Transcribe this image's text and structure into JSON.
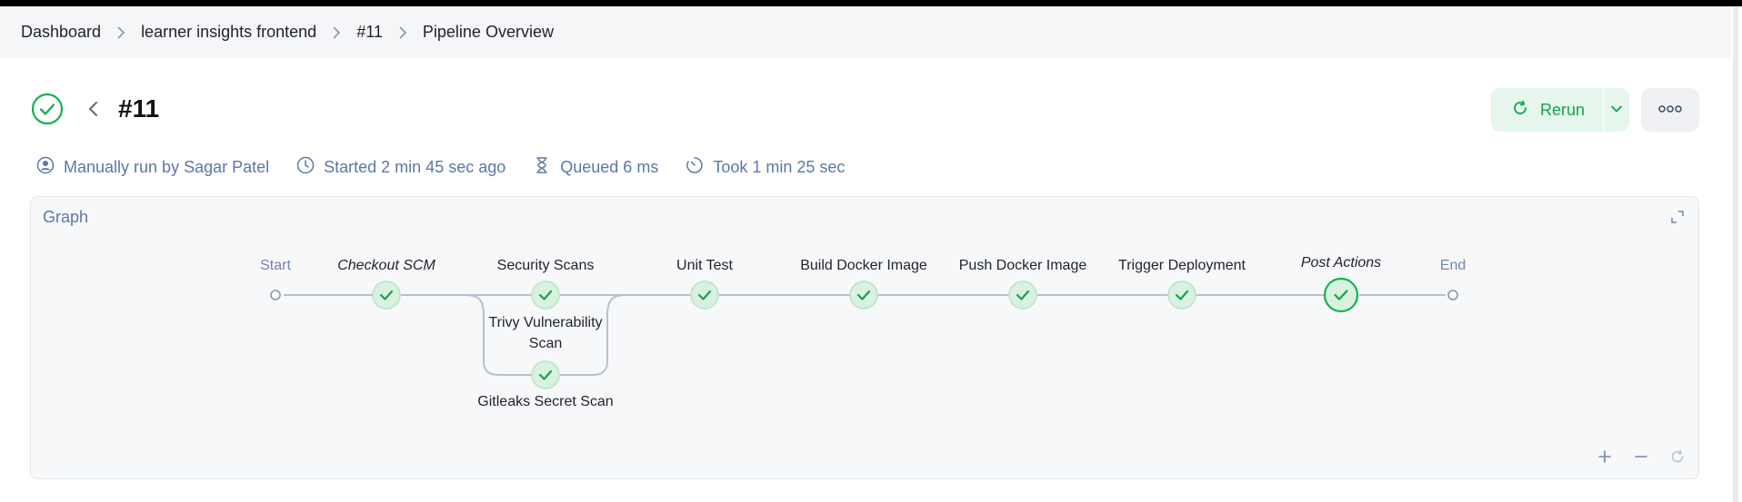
{
  "breadcrumb": {
    "items": [
      "Dashboard",
      "learner insights frontend",
      "#11",
      "Pipeline Overview"
    ]
  },
  "run": {
    "title": "#11",
    "status": "success",
    "status_icon": "check-circle-icon",
    "status_color": "#16b24f"
  },
  "actions": {
    "rerun_label": "Rerun",
    "rerun_icon": "refresh-icon",
    "caret_icon": "chevron-down-icon",
    "more_icon": "more-horizontal-icon",
    "accent_color": "#13a44d"
  },
  "meta": {
    "trigger": "Manually run by Sagar Patel",
    "started": "Started 2 min 45 sec ago",
    "queued": "Queued 6 ms",
    "took": "Took 1 min 25 sec"
  },
  "graph": {
    "title": "Graph",
    "start_label": "Start",
    "end_label": "End",
    "stages": [
      {
        "label": "Checkout SCM",
        "status": "success"
      },
      {
        "label": "Security Scans",
        "status": "success"
      },
      {
        "label": "Unit Test",
        "status": "success"
      },
      {
        "label": "Build Docker Image",
        "status": "success"
      },
      {
        "label": "Push Docker Image",
        "status": "success"
      },
      {
        "label": "Trigger Deployment",
        "status": "success"
      },
      {
        "label": "Post Actions",
        "status": "success"
      }
    ],
    "parallel_branches": [
      {
        "label": "Trivy Vulnerability Scan",
        "status": "success"
      },
      {
        "label": "Gitleaks Secret Scan",
        "status": "success"
      }
    ],
    "controls": {
      "zoom_in_icon": "plus-icon",
      "zoom_out_icon": "minus-icon",
      "reset_icon": "reset-icon",
      "expand_icon": "expand-icon"
    }
  }
}
